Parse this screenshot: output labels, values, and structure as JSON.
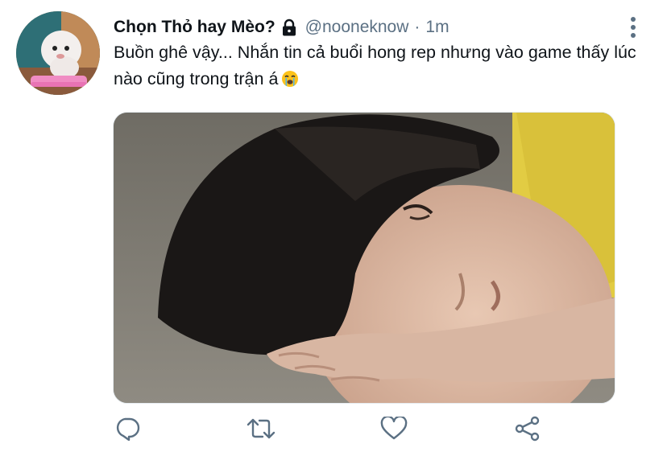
{
  "tweet": {
    "display_name": "Chọn Thỏ hay Mèo?",
    "handle": "@nooneknow",
    "separator": "·",
    "time": "1m",
    "text": "Buồn ghê vậy... Nhắn tin cả buổi hong rep nhưng vào game thấy lúc nào cũng trong trận á",
    "emoji": "crying-face-emoji"
  },
  "icons": {
    "protected": "lock-icon",
    "more": "more-vertical-icon",
    "reply": "reply-icon",
    "retweet": "retweet-icon",
    "like": "heart-icon",
    "share": "share-icon"
  },
  "colors": {
    "text": "#0f1419",
    "secondary": "#5b7083",
    "background": "#ffffff"
  }
}
